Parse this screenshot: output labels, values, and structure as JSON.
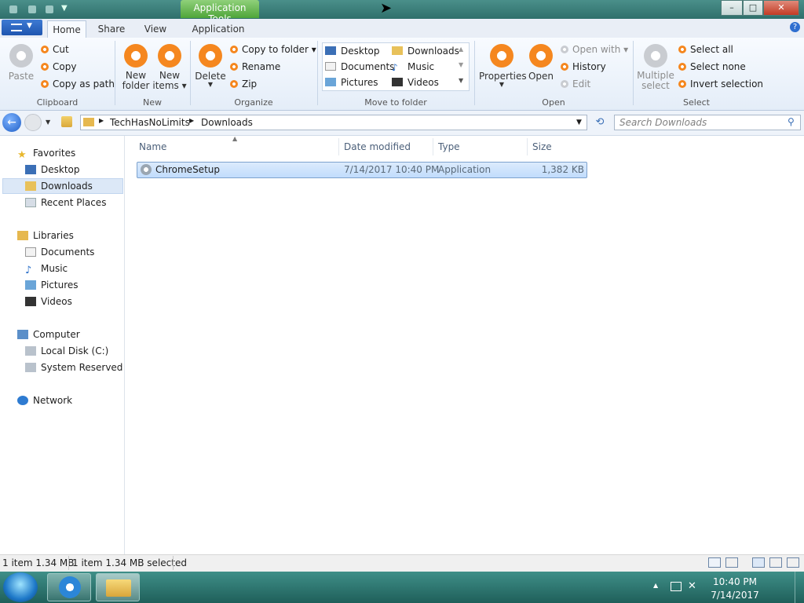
{
  "titlebar": {
    "context_tab": "Application Tools",
    "minimize": "–",
    "maximize": "□",
    "close": "✕"
  },
  "ribbon_tabs": [
    "Home",
    "Share",
    "View",
    "Application"
  ],
  "ribbon": {
    "clipboard": {
      "label": "Clipboard",
      "paste": "Paste",
      "cut": "Cut",
      "copy": "Copy",
      "copy_as_path": "Copy as path"
    },
    "new": {
      "label": "New",
      "new_folder_1": "New",
      "new_folder_2": "folder",
      "new_items_1": "New",
      "new_items_2": "items ▾"
    },
    "organize": {
      "label": "Organize",
      "delete": "Delete",
      "copy_to_folder": "Copy to folder ▾",
      "rename": "Rename",
      "zip": "Zip"
    },
    "move_to_folder": {
      "label": "Move to folder",
      "items": [
        "Desktop",
        "Downloads",
        "Documents",
        "Music",
        "Pictures",
        "Videos"
      ]
    },
    "open": {
      "label": "Open",
      "properties": "Properties",
      "open": "Open",
      "open_with": "Open with ▾",
      "history": "History",
      "edit": "Edit"
    },
    "select": {
      "label": "Select",
      "multiple_select_1": "Multiple",
      "multiple_select_2": "select",
      "select_all": "Select all",
      "select_none": "Select none",
      "invert_selection": "Invert selection"
    }
  },
  "address": {
    "breadcrumb": [
      "TechHasNoLimits",
      "Downloads"
    ],
    "search_placeholder": "Search Downloads"
  },
  "nav": {
    "favorites": "Favorites",
    "favorites_items": [
      "Desktop",
      "Downloads",
      "Recent Places"
    ],
    "libraries": "Libraries",
    "libraries_items": [
      "Documents",
      "Music",
      "Pictures",
      "Videos"
    ],
    "computer": "Computer",
    "computer_items": [
      "Local Disk (C:)",
      "System Reserved (D:"
    ],
    "network": "Network"
  },
  "columns": [
    "Name",
    "Date modified",
    "Type",
    "Size"
  ],
  "files": [
    {
      "name": "ChromeSetup",
      "date": "7/14/2017 10:40 PM",
      "type": "Application",
      "size": "1,382 KB"
    }
  ],
  "status": {
    "items": "1 item 1.34 MB",
    "selected": "1 item 1.34 MB selected"
  },
  "taskbar": {
    "time": "10:40 PM",
    "date": "7/14/2017"
  }
}
